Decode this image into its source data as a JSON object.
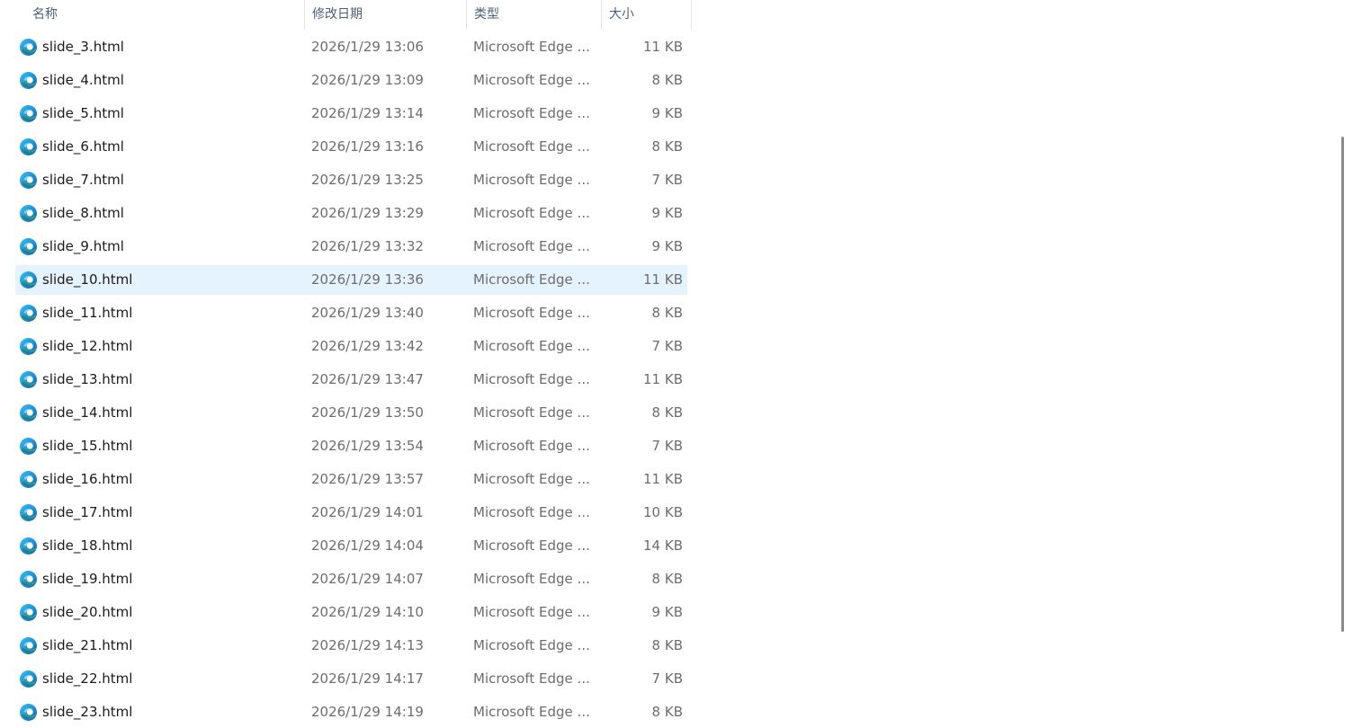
{
  "columns": {
    "name": "名称",
    "date": "修改日期",
    "type": "类型",
    "size": "大小"
  },
  "sort": {
    "column": "name",
    "direction": "ascending",
    "icon": "sort-up-chevron-icon"
  },
  "file_icon": "microsoft-edge-html-icon",
  "colors": {
    "selected_row": "#e5f3ff",
    "header_text": "#4c607a",
    "secondary_text": "#6d6d6d",
    "primary_text": "#1b1b1b"
  },
  "selected_index": 7,
  "files": [
    {
      "name": "slide_3.html",
      "date": "2026/1/29 13:06",
      "type": "Microsoft Edge ...",
      "size": "11 KB"
    },
    {
      "name": "slide_4.html",
      "date": "2026/1/29 13:09",
      "type": "Microsoft Edge ...",
      "size": "8 KB"
    },
    {
      "name": "slide_5.html",
      "date": "2026/1/29 13:14",
      "type": "Microsoft Edge ...",
      "size": "9 KB"
    },
    {
      "name": "slide_6.html",
      "date": "2026/1/29 13:16",
      "type": "Microsoft Edge ...",
      "size": "8 KB"
    },
    {
      "name": "slide_7.html",
      "date": "2026/1/29 13:25",
      "type": "Microsoft Edge ...",
      "size": "7 KB"
    },
    {
      "name": "slide_8.html",
      "date": "2026/1/29 13:29",
      "type": "Microsoft Edge ...",
      "size": "9 KB"
    },
    {
      "name": "slide_9.html",
      "date": "2026/1/29 13:32",
      "type": "Microsoft Edge ...",
      "size": "9 KB"
    },
    {
      "name": "slide_10.html",
      "date": "2026/1/29 13:36",
      "type": "Microsoft Edge ...",
      "size": "11 KB"
    },
    {
      "name": "slide_11.html",
      "date": "2026/1/29 13:40",
      "type": "Microsoft Edge ...",
      "size": "8 KB"
    },
    {
      "name": "slide_12.html",
      "date": "2026/1/29 13:42",
      "type": "Microsoft Edge ...",
      "size": "7 KB"
    },
    {
      "name": "slide_13.html",
      "date": "2026/1/29 13:47",
      "type": "Microsoft Edge ...",
      "size": "11 KB"
    },
    {
      "name": "slide_14.html",
      "date": "2026/1/29 13:50",
      "type": "Microsoft Edge ...",
      "size": "8 KB"
    },
    {
      "name": "slide_15.html",
      "date": "2026/1/29 13:54",
      "type": "Microsoft Edge ...",
      "size": "7 KB"
    },
    {
      "name": "slide_16.html",
      "date": "2026/1/29 13:57",
      "type": "Microsoft Edge ...",
      "size": "11 KB"
    },
    {
      "name": "slide_17.html",
      "date": "2026/1/29 14:01",
      "type": "Microsoft Edge ...",
      "size": "10 KB"
    },
    {
      "name": "slide_18.html",
      "date": "2026/1/29 14:04",
      "type": "Microsoft Edge ...",
      "size": "14 KB"
    },
    {
      "name": "slide_19.html",
      "date": "2026/1/29 14:07",
      "type": "Microsoft Edge ...",
      "size": "8 KB"
    },
    {
      "name": "slide_20.html",
      "date": "2026/1/29 14:10",
      "type": "Microsoft Edge ...",
      "size": "9 KB"
    },
    {
      "name": "slide_21.html",
      "date": "2026/1/29 14:13",
      "type": "Microsoft Edge ...",
      "size": "8 KB"
    },
    {
      "name": "slide_22.html",
      "date": "2026/1/29 14:17",
      "type": "Microsoft Edge ...",
      "size": "7 KB"
    },
    {
      "name": "slide_23.html",
      "date": "2026/1/29 14:19",
      "type": "Microsoft Edge ...",
      "size": "8 KB"
    }
  ]
}
